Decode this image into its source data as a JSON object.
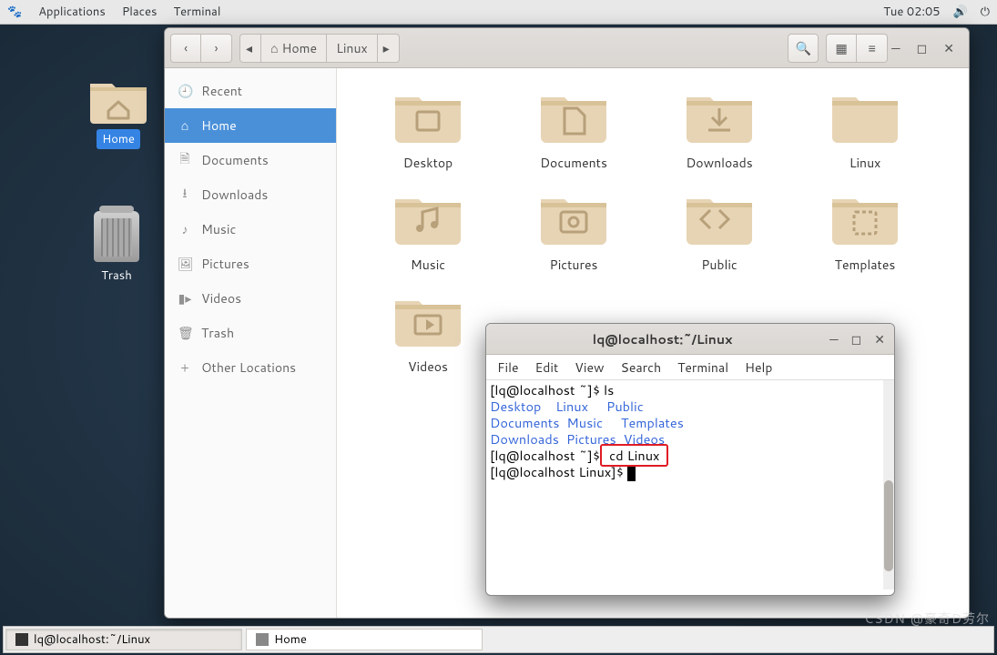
{
  "panel": {
    "applications": "Applications",
    "places": "Places",
    "terminal": "Terminal",
    "clock": "Tue 02:05"
  },
  "desktop": {
    "home_label": "Home",
    "trash_label": "Trash"
  },
  "files_window": {
    "path_home": "Home",
    "path_linux": "Linux",
    "sidebar": {
      "recent": "Recent",
      "home": "Home",
      "documents": "Documents",
      "downloads": "Downloads",
      "music": "Music",
      "pictures": "Pictures",
      "videos": "Videos",
      "trash": "Trash",
      "other": "Other Locations"
    },
    "folders": [
      "Desktop",
      "Documents",
      "Downloads",
      "Linux",
      "Music",
      "Pictures",
      "Public",
      "Templates",
      "Videos"
    ]
  },
  "terminal": {
    "title": "lq@localhost:~/Linux",
    "menu": {
      "file": "File",
      "edit": "Edit",
      "view": "View",
      "search": "Search",
      "terminal": "Terminal",
      "help": "Help"
    },
    "line1_prompt": "[lq@localhost ~]$ ",
    "line1_cmd": "ls",
    "ls_row1": {
      "a": "Desktop",
      "b": "Linux",
      "c": "Public"
    },
    "ls_row2": {
      "a": "Documents",
      "b": "Music",
      "c": "Templates"
    },
    "ls_row3": {
      "a": "Downloads",
      "b": "Pictures",
      "c": "Videos"
    },
    "line5_prompt": "[lq@localhost ~]$",
    "line5_cmd": " cd Linux ",
    "line6_prompt": "[lq@localhost Linux]$ "
  },
  "taskbar": {
    "task1": "lq@localhost:~/Linux",
    "task2": "Home"
  },
  "watermark": "CSDN @豪奇D劳尔"
}
